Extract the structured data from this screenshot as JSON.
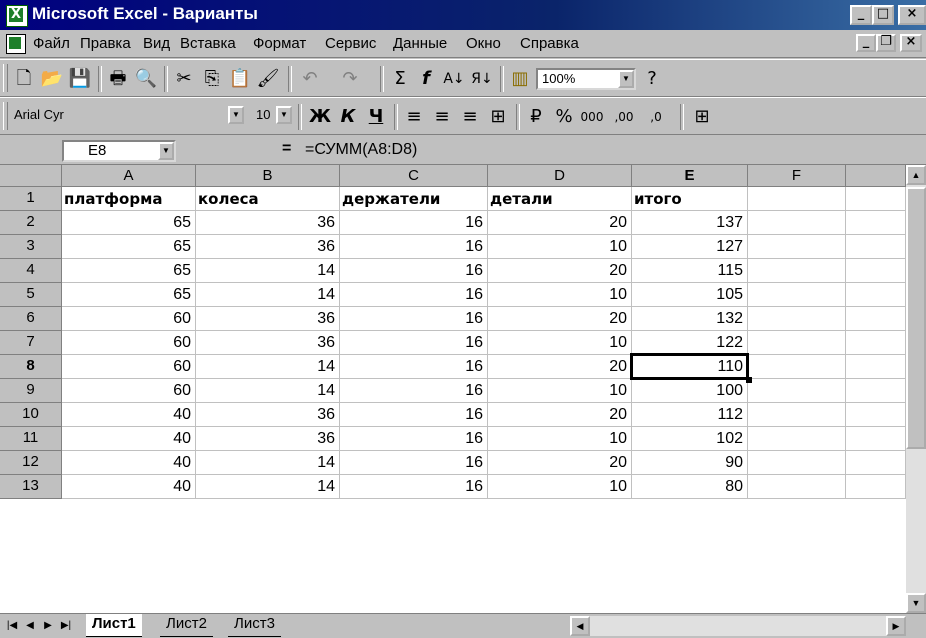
{
  "window": {
    "title": "Microsoft Excel - Варианты",
    "buttons": {
      "minimize": "_",
      "restore": "□",
      "close": "×"
    },
    "doc_buttons": {
      "minimize": "_",
      "restore": "❐",
      "close": "×"
    }
  },
  "menu": [
    {
      "label": "Файл"
    },
    {
      "label": "Правка"
    },
    {
      "label": "Вид"
    },
    {
      "label": "Вставка"
    },
    {
      "label": "Формат"
    },
    {
      "label": "Сервис"
    },
    {
      "label": "Данные"
    },
    {
      "label": "Окно"
    },
    {
      "label": "Справка"
    }
  ],
  "toolbar_standard": {
    "icons": [
      "new-icon",
      "open-icon",
      "save-icon",
      "print-icon",
      "print-preview-icon",
      "cut-icon",
      "copy-icon",
      "paste-icon",
      "format-painter-icon",
      "undo-icon",
      "redo-icon",
      "autosum-icon",
      "function-icon",
      "sort-ascending-icon",
      "sort-descending-icon",
      "chart-wizard-icon",
      "help-icon"
    ],
    "zoom": "100%"
  },
  "toolbar_formatting": {
    "font": "Arial Cyr",
    "size": "10",
    "icons": [
      "bold-icon",
      "italic-icon",
      "underline-icon",
      "align-left-icon",
      "align-center-icon",
      "align-right-icon",
      "merge-center-icon",
      "currency-icon",
      "percent-icon",
      "thousands-icon",
      "increase-decimal-icon",
      "decrease-decimal-icon",
      "borders-icon"
    ]
  },
  "formula_bar": {
    "name_box": "E8",
    "equals": "=",
    "formula": "=СУММ(A8:D8)"
  },
  "sheet": {
    "columns": [
      "A",
      "B",
      "C",
      "D",
      "E",
      "F"
    ],
    "row_numbers": [
      "1",
      "2",
      "3",
      "4",
      "5",
      "6",
      "7",
      "8",
      "9",
      "10",
      "11",
      "12",
      "13"
    ],
    "header_row": [
      "платформа",
      "колеса",
      "держатели",
      "детали",
      "итого"
    ],
    "rows": [
      [
        "65",
        "36",
        "16",
        "20",
        "137"
      ],
      [
        "65",
        "36",
        "16",
        "10",
        "127"
      ],
      [
        "65",
        "14",
        "16",
        "20",
        "115"
      ],
      [
        "65",
        "14",
        "16",
        "10",
        "105"
      ],
      [
        "60",
        "36",
        "16",
        "20",
        "132"
      ],
      [
        "60",
        "36",
        "16",
        "10",
        "122"
      ],
      [
        "60",
        "14",
        "16",
        "20",
        "110"
      ],
      [
        "60",
        "14",
        "16",
        "10",
        "100"
      ],
      [
        "40",
        "36",
        "16",
        "20",
        "112"
      ],
      [
        "40",
        "36",
        "16",
        "10",
        "102"
      ],
      [
        "40",
        "14",
        "16",
        "20",
        "90"
      ],
      [
        "40",
        "14",
        "16",
        "10",
        "80"
      ]
    ],
    "selected_cell": "E8"
  },
  "tabs": [
    {
      "label": "Лист1",
      "active": true
    },
    {
      "label": "Лист2"
    },
    {
      "label": "Лист3"
    }
  ]
}
